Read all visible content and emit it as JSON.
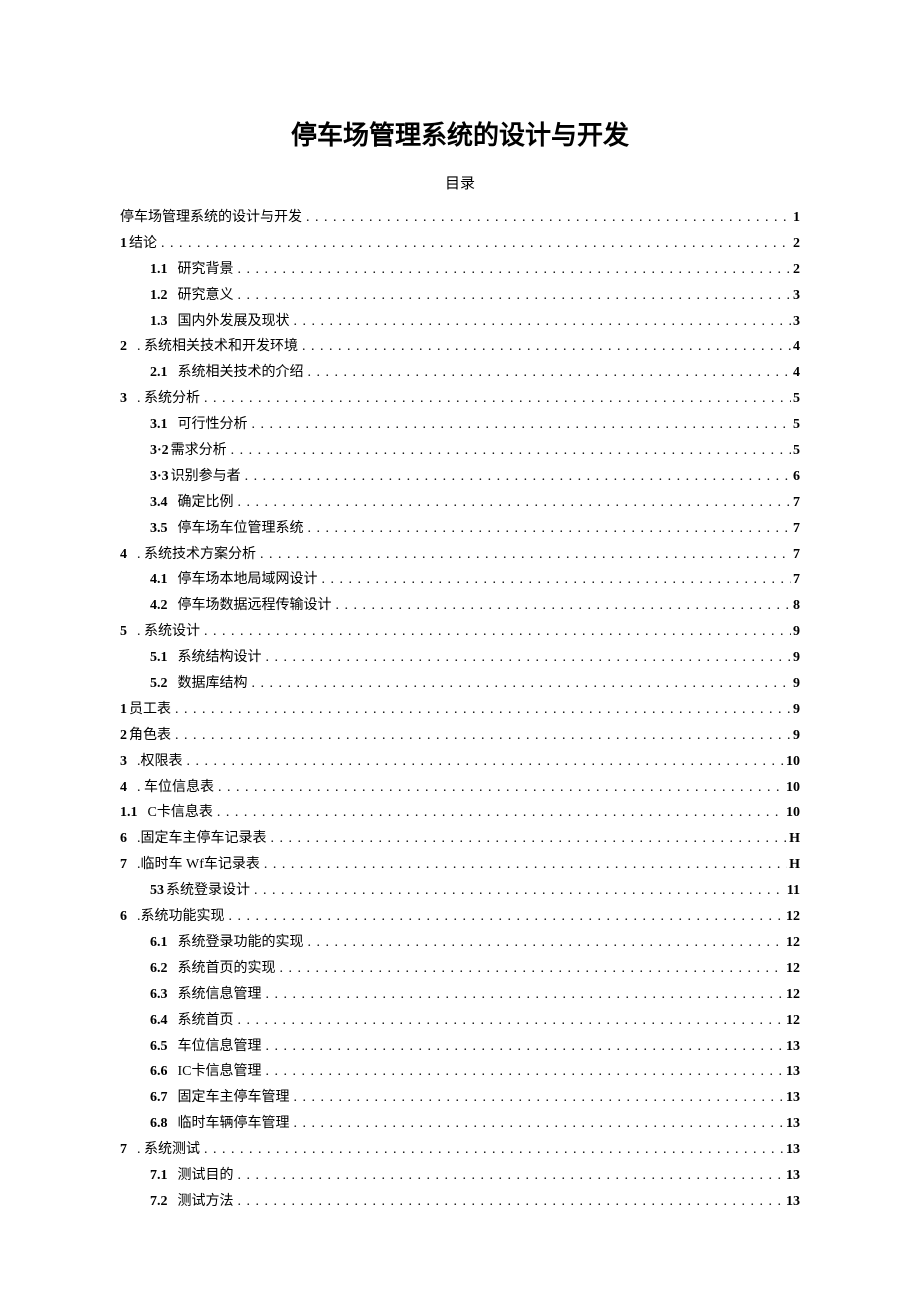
{
  "title": "停车场管理系统的设计与开发",
  "toc_heading": "目录",
  "entries": [
    {
      "indent": 0,
      "num": "",
      "text": "停车场管理系统的设计与开发",
      "page": "1"
    },
    {
      "indent": 0,
      "num": "1",
      "text": "结论",
      "page": "2",
      "tightNum": true
    },
    {
      "indent": 1,
      "num": "1.1",
      "text": "研究背景",
      "page": "2"
    },
    {
      "indent": 1,
      "num": "1.2",
      "text": "研究意义",
      "page": "3"
    },
    {
      "indent": 1,
      "num": "1.3",
      "text": "国内外发展及现状",
      "page": "3"
    },
    {
      "indent": 0,
      "num": "2",
      "text": ". 系统相关技术和开发环境",
      "page": "4"
    },
    {
      "indent": 1,
      "num": "2.1",
      "text": "系统相关技术的介绍",
      "page": "4"
    },
    {
      "indent": 0,
      "num": "3",
      "text": ". 系统分析",
      "page": "5"
    },
    {
      "indent": 1,
      "num": "3.1",
      "text": "可行性分析",
      "page": "5"
    },
    {
      "indent": 1,
      "num": "3·2",
      "text": "需求分析",
      "page": "5",
      "tightNum": true
    },
    {
      "indent": 1,
      "num": "3·3",
      "text": "识别参与者",
      "page": "6",
      "tightNum": true
    },
    {
      "indent": 1,
      "num": "3.4",
      "text": "确定比例",
      "page": "7"
    },
    {
      "indent": 1,
      "num": "3.5",
      "text": "停车场车位管理系统",
      "page": "7"
    },
    {
      "indent": 0,
      "num": "4",
      "text": ". 系统技术方案分析",
      "page": "7"
    },
    {
      "indent": 1,
      "num": "4.1",
      "text": "停车场本地局域网设计",
      "page": "7"
    },
    {
      "indent": 1,
      "num": "4.2",
      "text": "停车场数据远程传输设计",
      "page": "8"
    },
    {
      "indent": 0,
      "num": "5",
      "text": ". 系统设计",
      "page": "9"
    },
    {
      "indent": 1,
      "num": "5.1",
      "text": "系统结构设计",
      "page": "9"
    },
    {
      "indent": 1,
      "num": "5.2",
      "text": "数据库结构",
      "page": "9"
    },
    {
      "indent": 0,
      "num": "1",
      "text": "员工表",
      "page": "9",
      "tightNum": true
    },
    {
      "indent": 0,
      "num": "2",
      "text": "角色表",
      "page": "9",
      "tightNum": true
    },
    {
      "indent": 0,
      "num": "3",
      "text": ".权限表",
      "page": "10"
    },
    {
      "indent": 0,
      "num": "4",
      "text": ". 车位信息表",
      "page": "10"
    },
    {
      "indent": 0,
      "num": "1.1",
      "text": "C卡信息表",
      "page": "10"
    },
    {
      "indent": 0,
      "num": "6",
      "text": ".固定车主停车记录表",
      "page": "H",
      "cnPage": true
    },
    {
      "indent": 0,
      "num": "7",
      "text": ".临时车 Wf车记录表",
      "page": "H",
      "cnPage": true
    },
    {
      "indent": 1,
      "num": "53",
      "text": "系统登录设计",
      "page": "11",
      "tightNum": true
    },
    {
      "indent": 0,
      "num": "6",
      "text": ".系统功能实现",
      "page": "12"
    },
    {
      "indent": 1,
      "num": "6.1",
      "text": "系统登录功能的实现",
      "page": "12"
    },
    {
      "indent": 1,
      "num": "6.2",
      "text": "系统首页的实现",
      "page": "12"
    },
    {
      "indent": 1,
      "num": "6.3",
      "text": "系统信息管理",
      "page": "12"
    },
    {
      "indent": 1,
      "num": "6.4",
      "text": "系统首页",
      "page": "12"
    },
    {
      "indent": 1,
      "num": "6.5",
      "text": "车位信息管理",
      "page": "13"
    },
    {
      "indent": 1,
      "num": "6.6",
      "text": "IC卡信息管理",
      "page": "13"
    },
    {
      "indent": 1,
      "num": "6.7",
      "text": "固定车主停车管理",
      "page": "13"
    },
    {
      "indent": 1,
      "num": "6.8",
      "text": "临时车辆停车管理",
      "page": "13"
    },
    {
      "indent": 0,
      "num": "7",
      "text": ". 系统测试",
      "page": "13"
    },
    {
      "indent": 1,
      "num": "7.1",
      "text": "测试目的",
      "page": "13"
    },
    {
      "indent": 1,
      "num": "7.2",
      "text": "测试方法",
      "page": "13"
    }
  ]
}
